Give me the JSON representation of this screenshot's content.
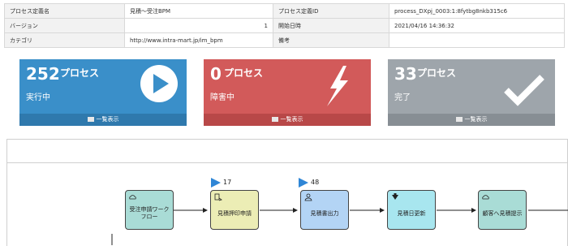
{
  "info": {
    "rows": [
      {
        "l1": "プロセス定義名",
        "v1": "見積～受注BPM",
        "l2": "プロセス定義ID",
        "v2": "process_DXpj_0003:1:8fytbg8nkb315c6"
      },
      {
        "l1": "バージョン",
        "v1": "1",
        "l2": "開始日時",
        "v2": "2021/04/16 14:36:32"
      },
      {
        "l1": "カテゴリ",
        "v1": "http://www.intra-mart.jp/im_bpm",
        "l2": "備考",
        "v2": ""
      }
    ]
  },
  "cards": {
    "running": {
      "count": "252",
      "unit": "プロセス",
      "state": "実行中",
      "link": "一覧表示",
      "color": "#3a8fc9"
    },
    "error": {
      "count": "0",
      "unit": "プロセス",
      "state": "障害中",
      "link": "一覧表示",
      "color": "#d25a5a"
    },
    "done": {
      "count": "33",
      "unit": "プロセス",
      "state": "完了",
      "link": "一覧表示",
      "color": "#9ea5ab"
    }
  },
  "diagram": {
    "nodes": [
      {
        "label": "受注申請ワーク\nフロー",
        "icon": "cloud-user-icon",
        "color": "#a9dcd6"
      },
      {
        "label": "見積押印申請",
        "icon": "workflow-doc-icon",
        "color": "#ecedb5"
      },
      {
        "label": "見積書出力",
        "icon": "user-task-icon",
        "color": "#b3d4f5"
      },
      {
        "label": "見積日更新",
        "icon": "arrow-down-icon",
        "color": "#a8e6ef"
      },
      {
        "label": "顧客へ見積提示",
        "icon": "cloud-user-icon",
        "color": "#a9dcd6"
      }
    ],
    "markers": [
      {
        "count": "17"
      },
      {
        "count": "48"
      }
    ]
  }
}
